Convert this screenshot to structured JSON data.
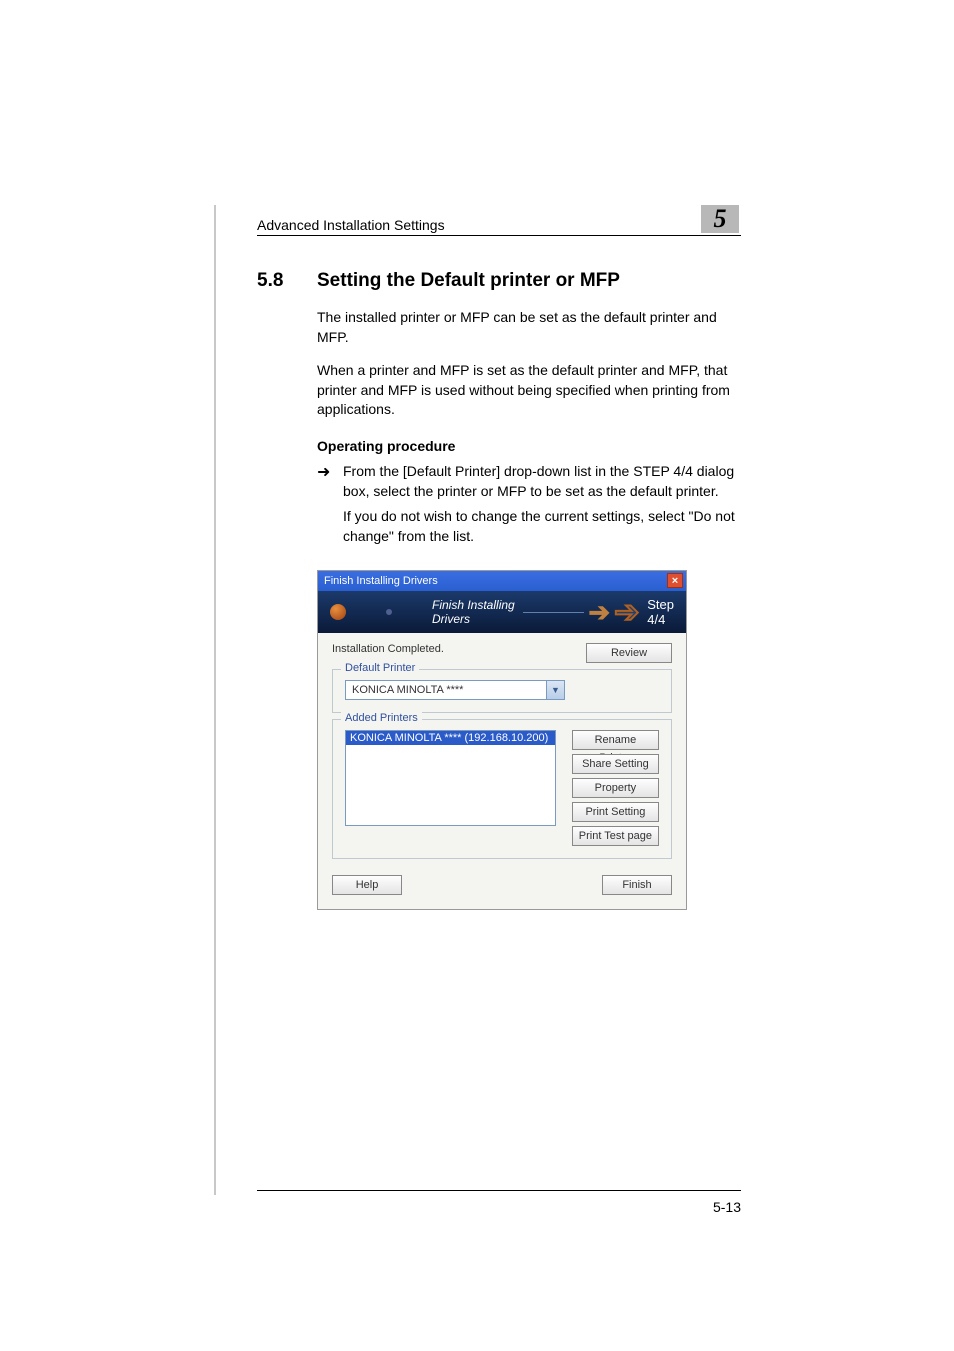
{
  "header": {
    "breadcrumb": "Advanced Installation Settings",
    "chapter_number": "5"
  },
  "section": {
    "number": "5.8",
    "title": "Setting the Default printer or MFP"
  },
  "paragraphs": {
    "p1": "The installed printer or MFP can be set as the default printer and MFP.",
    "p2": "When a printer and MFP is set as the default printer and MFP, that printer and MFP is used without being specified when printing from applications."
  },
  "operating": {
    "heading": "Operating procedure",
    "arrow": "➜",
    "step_main": "From the [Default Printer] drop-down list in the STEP 4/4 dialog box, select the printer or MFP to be set as the default printer.",
    "step_sub": "If you do not wish to change the current settings, select \"Do not change\" from the list."
  },
  "dialog": {
    "title": "Finish Installing Drivers",
    "close_glyph": "×",
    "banner_title": "Finish Installing Drivers",
    "step_label": "Step 4/4",
    "install_complete": "Installation Completed.",
    "review_btn": "Review",
    "group_default": "Default Printer",
    "default_value": "KONICA MINOLTA ****",
    "combo_arrow": "▼",
    "group_added": "Added Printers",
    "added_selected": "KONICA MINOLTA **** (192.168.10.200)",
    "buttons": {
      "rename": "Rename Printer",
      "share": "Share Setting",
      "property": "Property",
      "print_setting": "Print Setting",
      "test_page": "Print Test page"
    },
    "help_btn": "Help",
    "finish_btn": "Finish"
  },
  "footer": {
    "page_number": "5-13"
  }
}
